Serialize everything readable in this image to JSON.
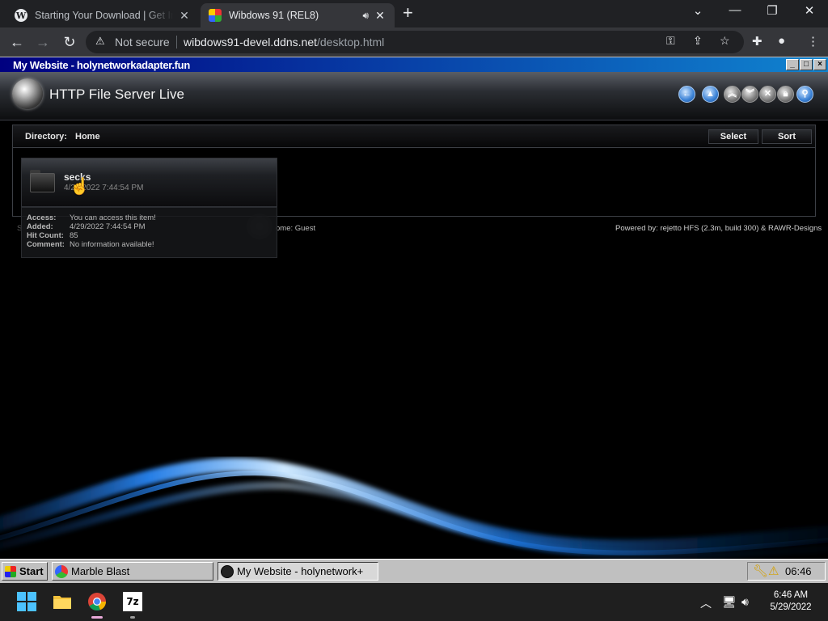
{
  "browser": {
    "tabs": [
      {
        "title": "Starting Your Download | Get Int",
        "favicon": "wordpress-icon",
        "active": false
      },
      {
        "title": "Wibdows 91 (REL8)",
        "favicon": "wibdows-icon",
        "active": true,
        "audio": true
      }
    ],
    "address": {
      "security_label": "Not secure",
      "host": "wibdows91-devel.ddns.net",
      "path": "/desktop.html"
    }
  },
  "window": {
    "title": "My Website - holynetworkadapter.fun",
    "controls": [
      "_",
      "□",
      "×"
    ]
  },
  "hfs": {
    "title": "HTTP File Server Live",
    "directory_label": "Directory:",
    "directory_value": "Home",
    "select_label": "Select",
    "sort_label": "Sort",
    "item": {
      "name": "secks",
      "date": "4/29/2022 7:44:54 PM"
    },
    "details": {
      "access_label": "Access:",
      "access_value": "You can access this item!",
      "added_label": "Added:",
      "added_value": "4/29/2022 7:44:54 PM",
      "hits_label": "Hit Count:",
      "hits_value": "85",
      "comment_label": "Comment:",
      "comment_value": "No information available!"
    },
    "footer_left_start": "S",
    "footer_left_end": "ome: Guest",
    "footer_right": "Powered by: rejetto HFS (2.3m, build 300) & RAWR-Designs"
  },
  "taskbar98": {
    "start_label": "Start",
    "tasks": [
      {
        "label": "Marble Blast",
        "pressed": false
      },
      {
        "label": "My Website - holynetwork+",
        "pressed": true
      }
    ],
    "clock": "06:46"
  },
  "win11": {
    "time": "6:46 AM",
    "date": "5/29/2022"
  }
}
